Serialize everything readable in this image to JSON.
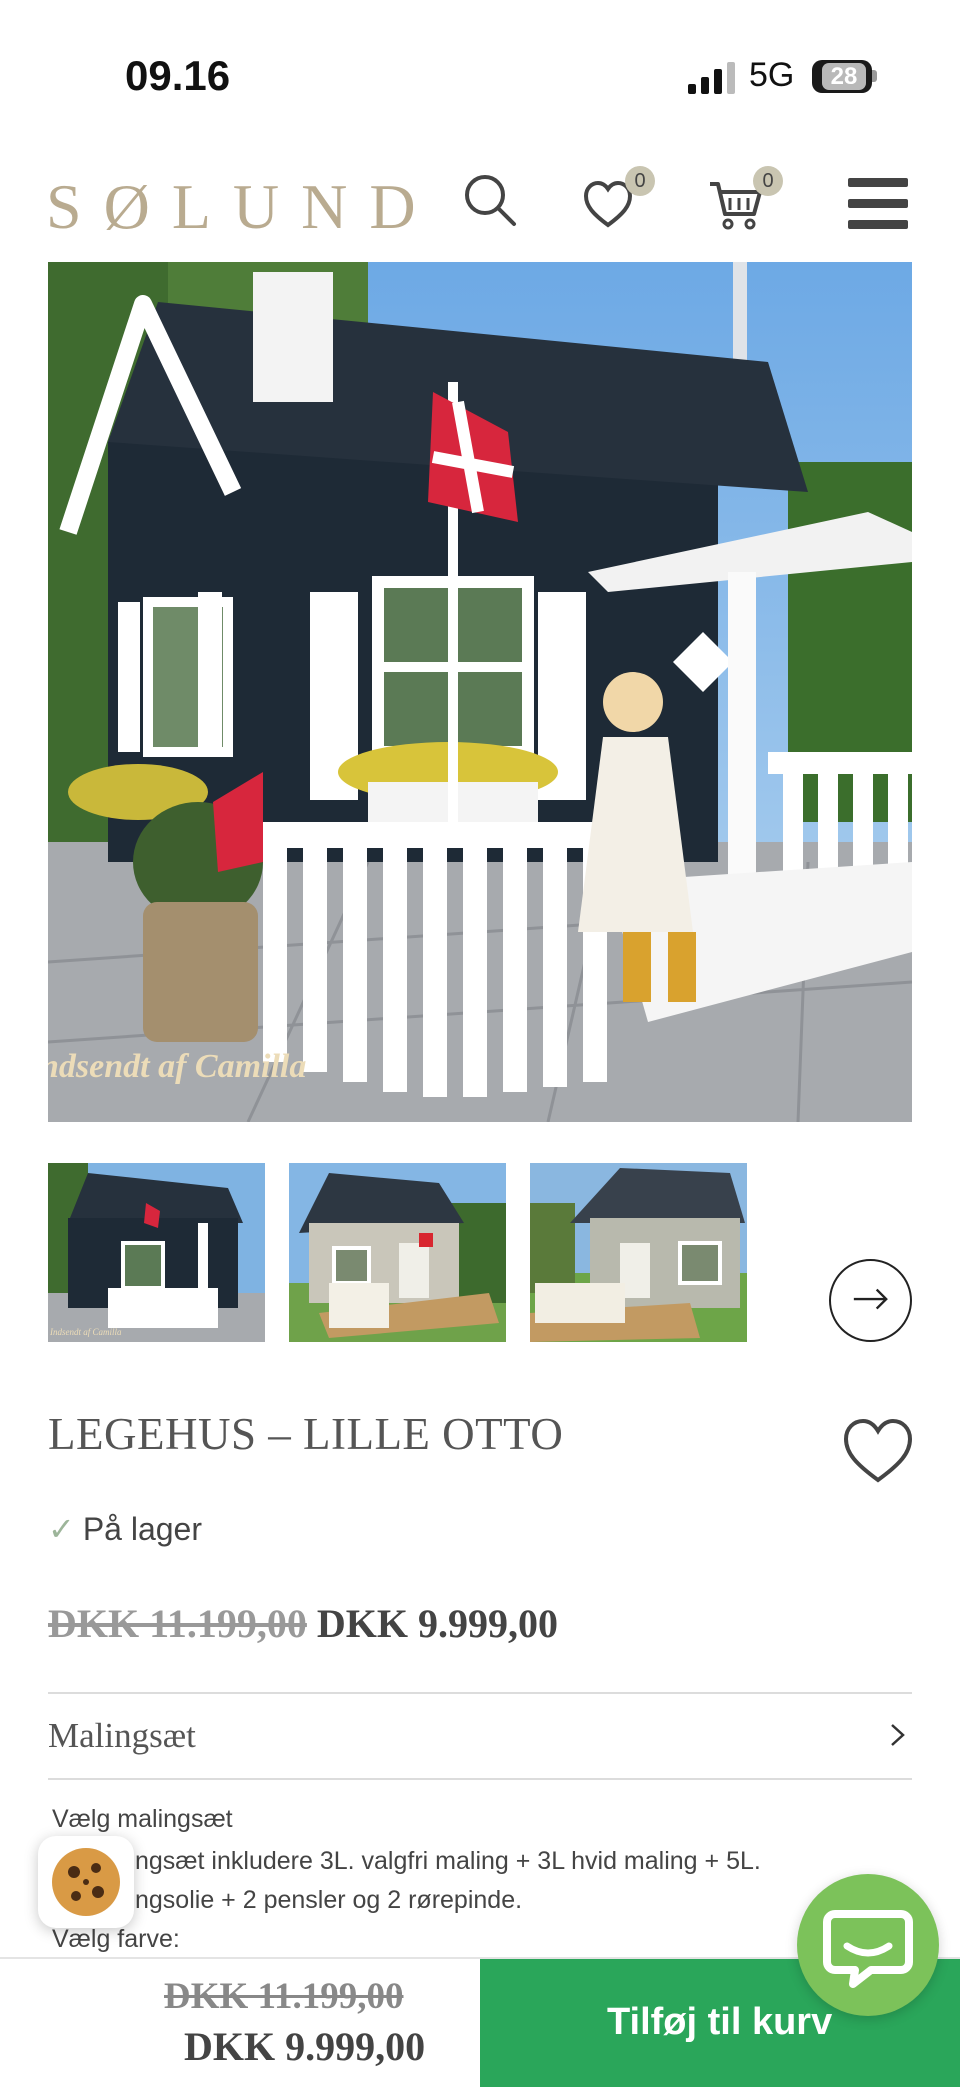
{
  "status_bar": {
    "time": "09.16",
    "network": "5G",
    "battery": "28"
  },
  "header": {
    "logo": "SØLUND",
    "wishlist_count": "0",
    "cart_count": "0",
    "icons": [
      "search-icon",
      "heart-icon",
      "cart-icon",
      "hamburger-menu-icon"
    ]
  },
  "gallery": {
    "main_image_caption": "ndsendt af Camilla",
    "thumbnail_caption": "Indsendt af Camilla",
    "next_icon": "arrow-right-icon"
  },
  "product": {
    "title": "LEGEHUS – LILLE OTTO",
    "stock_status": "På lager",
    "old_price": "DKK 11.199,00",
    "price": "DKK 9.999,00"
  },
  "accordion": {
    "label": "Malingsæt"
  },
  "options": {
    "choose_paint_kit": "Vælg malingsæt",
    "line2": "ngsæt inkludere 3L. valgfri maling + 3L hvid maling + 5L.",
    "line3": "ngsolie + 2 pensler og 2 rørepinde.",
    "choose_color": "Vælg farve:"
  },
  "bottom_bar": {
    "old_price": "DKK 11.199,00",
    "price": "DKK 9.999,00",
    "add_to_cart": "Tilføj til kurv"
  },
  "colors": {
    "brand": "#b9ab90",
    "add_to_cart": "#2aa65a",
    "chat": "#7cc25a",
    "badge": "#c9c5b1"
  }
}
